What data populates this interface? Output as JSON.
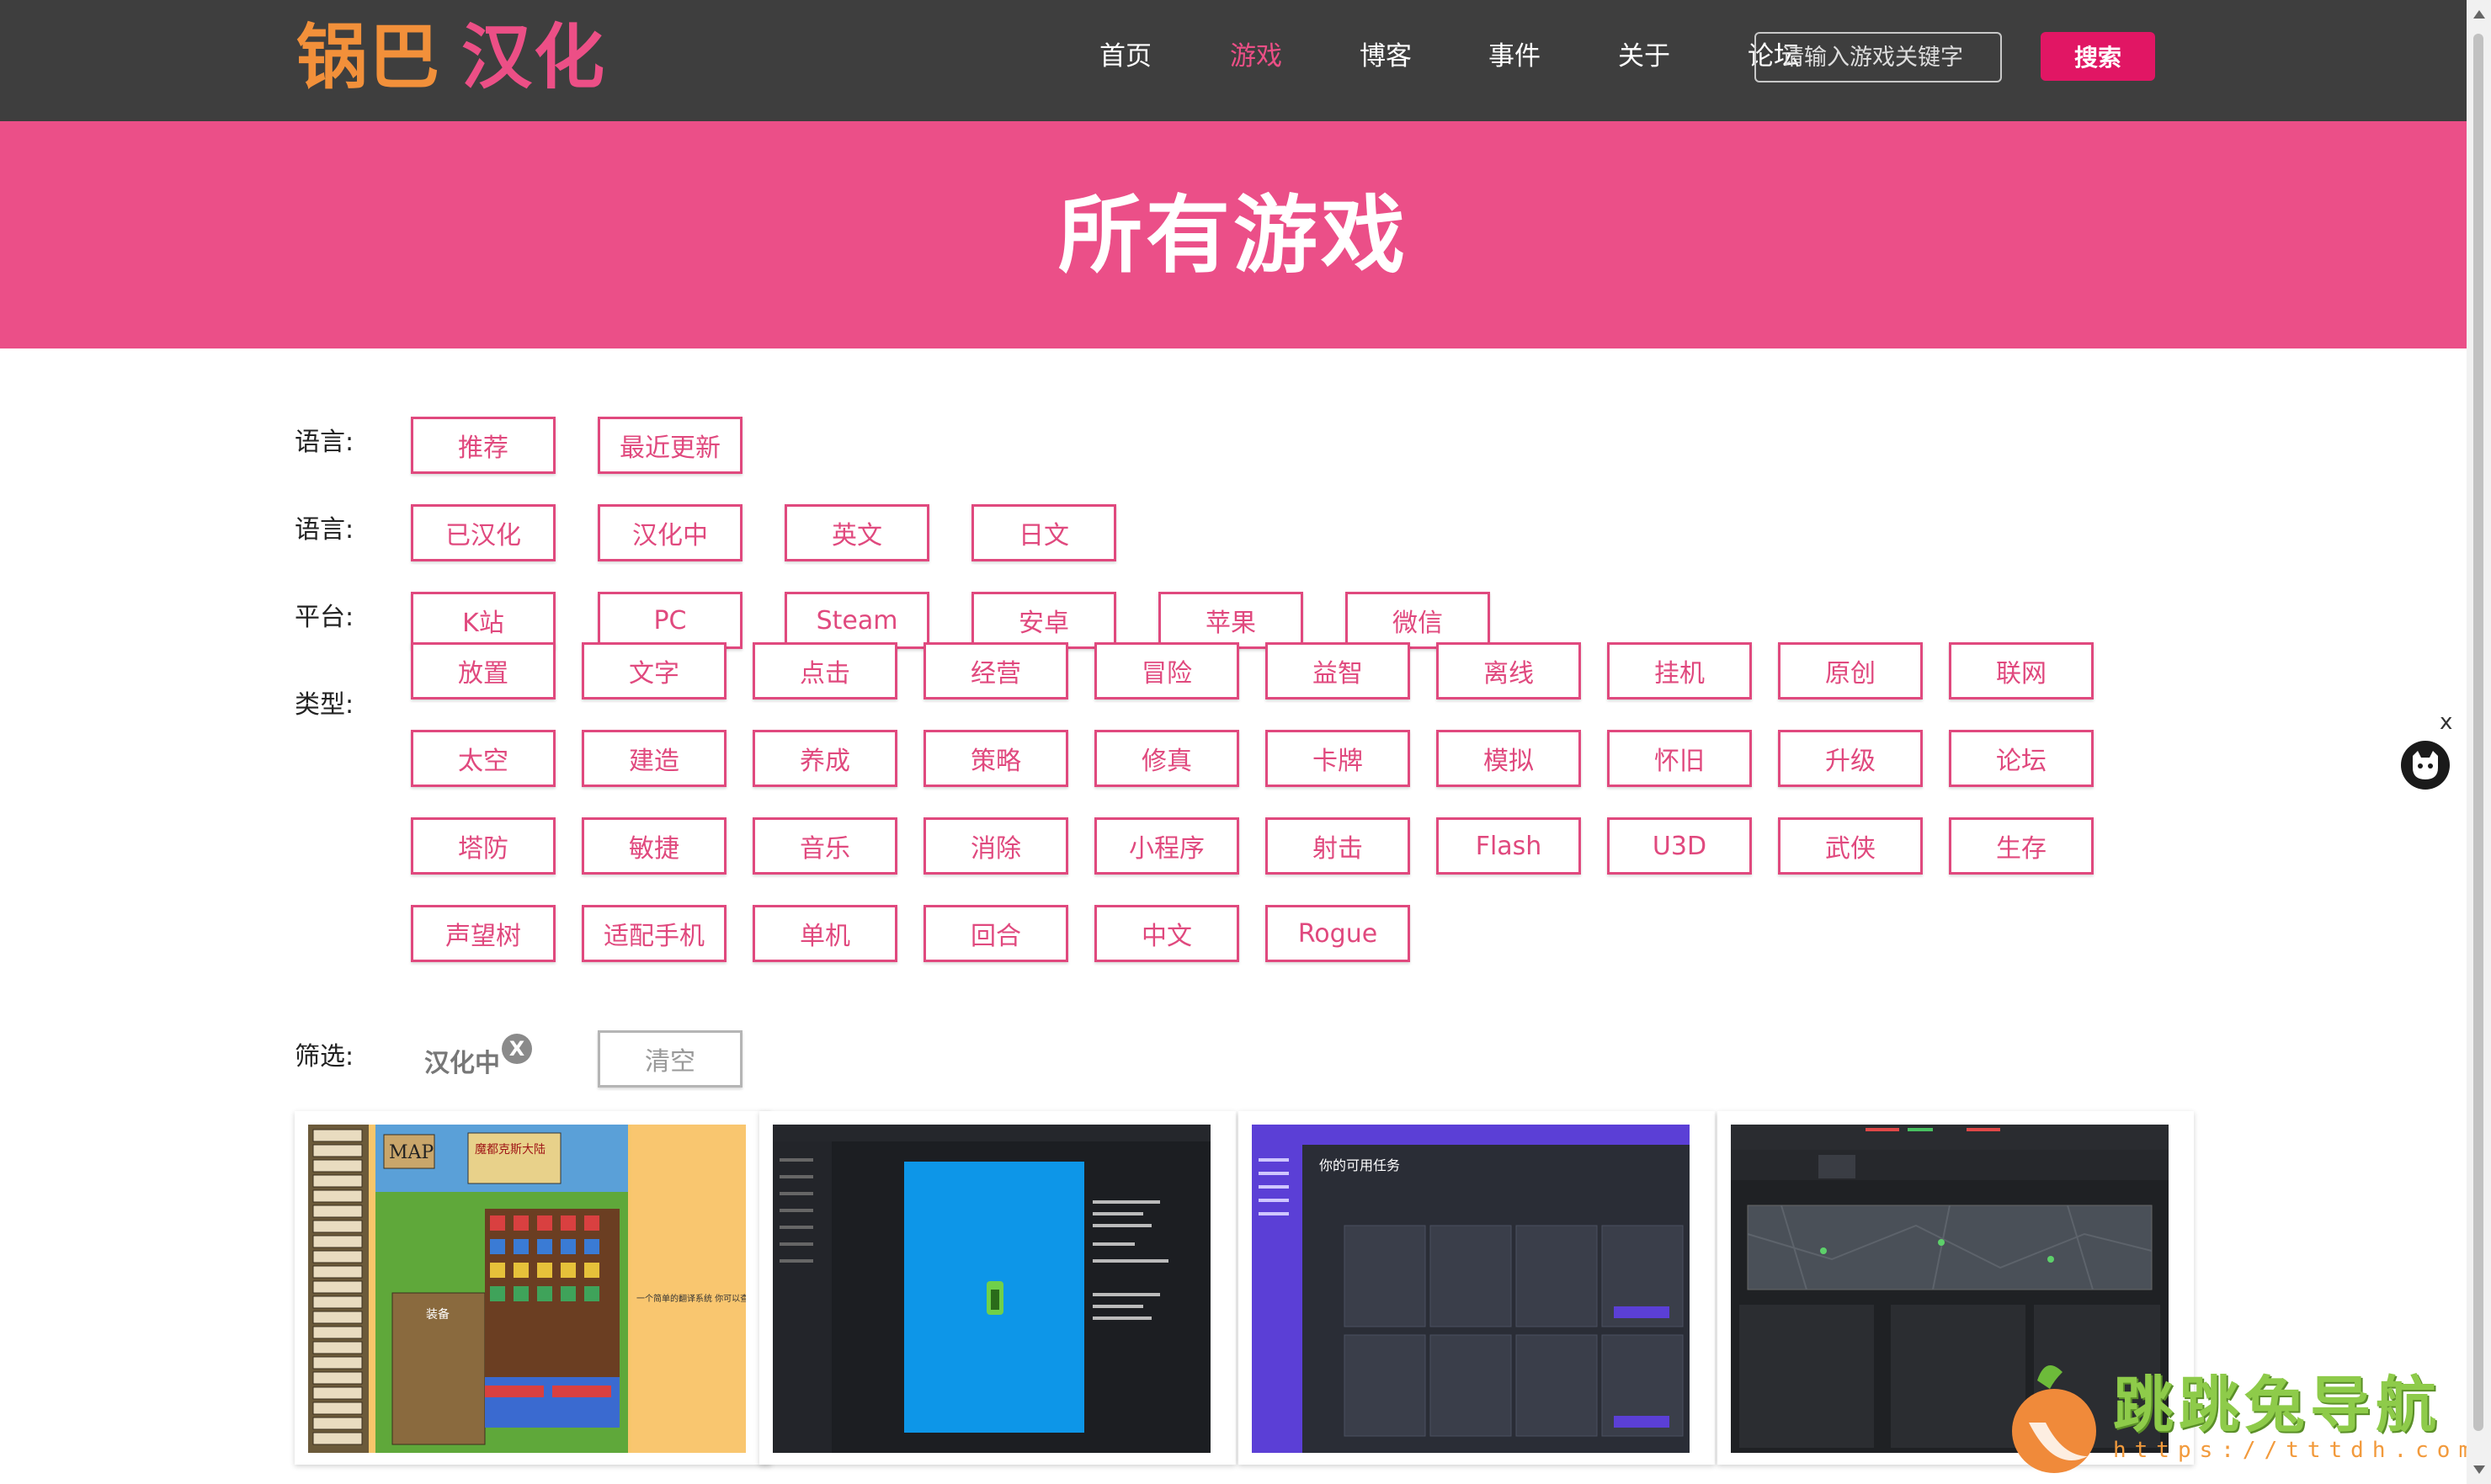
{
  "header": {
    "logo_part1": "锅巴",
    "logo_part2": "汉化",
    "nav": [
      "首页",
      "游戏",
      "博客",
      "事件",
      "关于",
      "论坛"
    ],
    "active_nav": "游戏",
    "search_placeholder": "请输入游戏关键字",
    "search_button": "搜索"
  },
  "banner": {
    "title": "所有游戏"
  },
  "filters": {
    "row1": {
      "label": "语言:",
      "tags": [
        "推荐",
        "最近更新"
      ]
    },
    "row2": {
      "label": "语言:",
      "tags": [
        "已汉化",
        "汉化中",
        "英文",
        "日文"
      ]
    },
    "row3": {
      "label": "平台:",
      "tags": [
        "K站",
        "PC",
        "Steam",
        "安卓",
        "苹果",
        "微信"
      ]
    },
    "row4": {
      "label": "类型:",
      "tags": [
        "放置",
        "文字",
        "点击",
        "经营",
        "冒险",
        "益智",
        "离线",
        "挂机",
        "原创",
        "联网",
        "太空",
        "建造",
        "养成",
        "策略",
        "修真",
        "卡牌",
        "模拟",
        "怀旧",
        "升级",
        "论坛",
        "塔防",
        "敏捷",
        "音乐",
        "消除",
        "小程序",
        "射击",
        "Flash",
        "U3D",
        "武侠",
        "生存",
        "声望树",
        "适配手机",
        "单机",
        "回合",
        "中文",
        "Rogue"
      ]
    },
    "row5": {
      "label": "筛选:",
      "chosen": "汉化中",
      "remove": "X",
      "clear": "清空"
    }
  },
  "cards": {
    "c1": {
      "map_label": "MAP",
      "title": "魔都克斯大陆",
      "panel_title": "装备",
      "note": "一个简单的翻译系统 你可以查看这里和英语提示 你们交流"
    },
    "c2": {},
    "c3": {
      "heading": "你的可用任务"
    },
    "c4": {}
  },
  "floating": {
    "close": "x"
  },
  "watermark": {
    "text": "跳跳兔导航",
    "url": "https://tttdh.com"
  },
  "colors": {
    "header_bg": "#3e3e3e",
    "accent": "#eb4f88",
    "tag_border": "#e0497e",
    "logo_orange": "#f2903a",
    "search_btn": "#e11664"
  }
}
